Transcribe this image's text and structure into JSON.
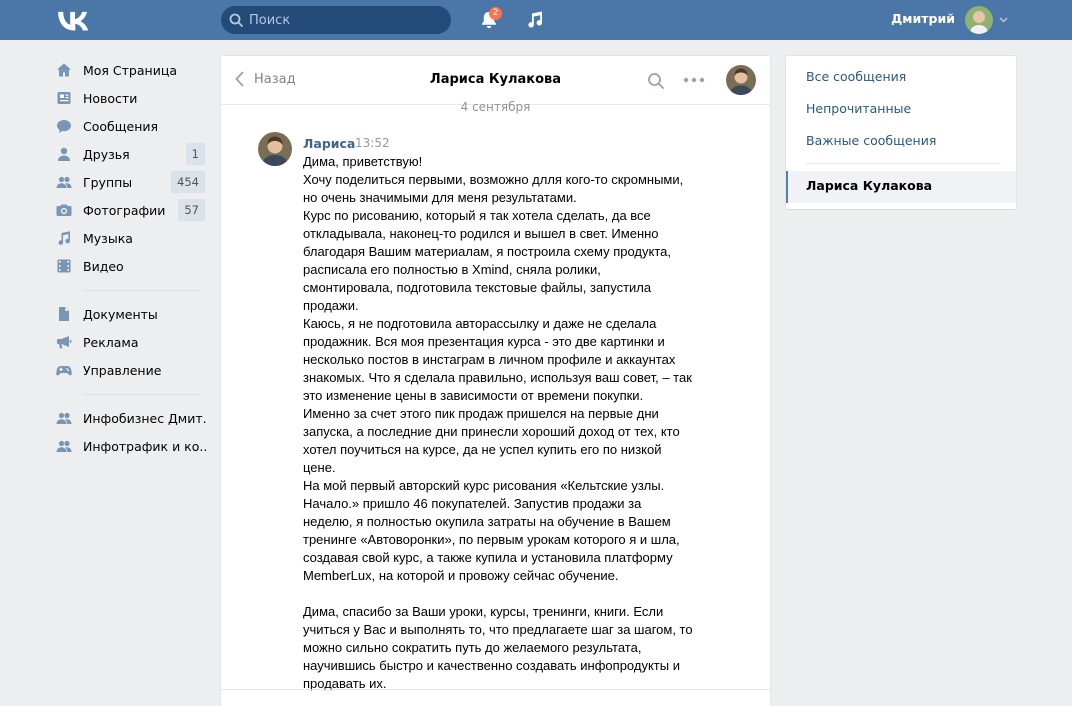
{
  "topbar": {
    "search_placeholder": "Поиск",
    "notifications_count": "2",
    "user_name": "Дмитрий"
  },
  "leftnav": {
    "main": [
      {
        "label": "Моя Страница",
        "icon": "home-icon"
      },
      {
        "label": "Новости",
        "icon": "news-icon"
      },
      {
        "label": "Сообщения",
        "icon": "messages-icon"
      },
      {
        "label": "Друзья",
        "icon": "friends-icon",
        "count": "1"
      },
      {
        "label": "Группы",
        "icon": "groups-icon",
        "count": "454"
      },
      {
        "label": "Фотографии",
        "icon": "camera-icon",
        "count": "57"
      },
      {
        "label": "Музыка",
        "icon": "music-icon"
      },
      {
        "label": "Видео",
        "icon": "video-icon"
      }
    ],
    "secondary": [
      {
        "label": "Документы",
        "icon": "document-icon"
      },
      {
        "label": "Реклама",
        "icon": "megaphone-icon"
      },
      {
        "label": "Управление",
        "icon": "gamepad-icon"
      }
    ],
    "communities": [
      {
        "label": "Инфобизнес Дмит..",
        "icon": "community-icon"
      },
      {
        "label": "Инфотрафик и ко..",
        "icon": "community-icon"
      }
    ]
  },
  "conversation": {
    "back_label": "Назад",
    "title": "Лариса Кулакова",
    "date": "4 сентября",
    "message": {
      "author": "Лариса",
      "time": "13:52",
      "text": "Дима, приветствую!\nХочу поделиться первыми, возможно длля кого-то скромными, но очень значимыми для меня результатами.\nКурс по рисованию, который я так хотела сделать, да все откладывала, наконец-то родился и вышел в свет. Именно благодаря Вашим материалам, я построила схему продукта, расписала его полностью в Xmind, сняла ролики, смонтировала, подготовила текстовые файлы, запустила продажи.\nКаюсь, я не подготовила авторассылку и даже не сделала продажник. Вся моя презентация курса - это две картинки и несколько постов в инстаграм в личном профиле и аккаунтах знакомых. Что я сделала правильно, используя ваш совет, – так это изменение цены в зависимости от времени покупки. Именно за счет этого пик продаж пришелся на первые дни запуска, а последние дни принесли хороший доход от тех, кто хотел поучиться на курсе, да не успел купить его по низкой цене.\nНа мой первый авторский курс рисования «Кельтские узлы. Начало.» пришло 46 покупателей. Запустив продажи за неделю, я полностью окупила затраты на обучение в Вашем тренинге «Автоворонки», по первым урокам которого я и шла, создавая свой курс, а также купила и установила платформу MemberLux, на которой и провожу сейчас обучение.\n\nДима, спасибо за Ваши уроки, курсы, тренинги, книги. Если учиться у Вас и выполнять то, что предлагаете шаг за шагом, то можно сильно сократить путь до желаемого результата, научившись быстро и качественно создавать инфопродукты и продавать их."
    }
  },
  "rightbox": {
    "items": [
      "Все сообщения",
      "Непрочитанные",
      "Важные сообщения"
    ],
    "active": "Лариса Кулакова"
  },
  "colors": {
    "header": "#4a76a8",
    "link": "#2a5885",
    "author": "#42648b",
    "badge": "#ff734c"
  }
}
